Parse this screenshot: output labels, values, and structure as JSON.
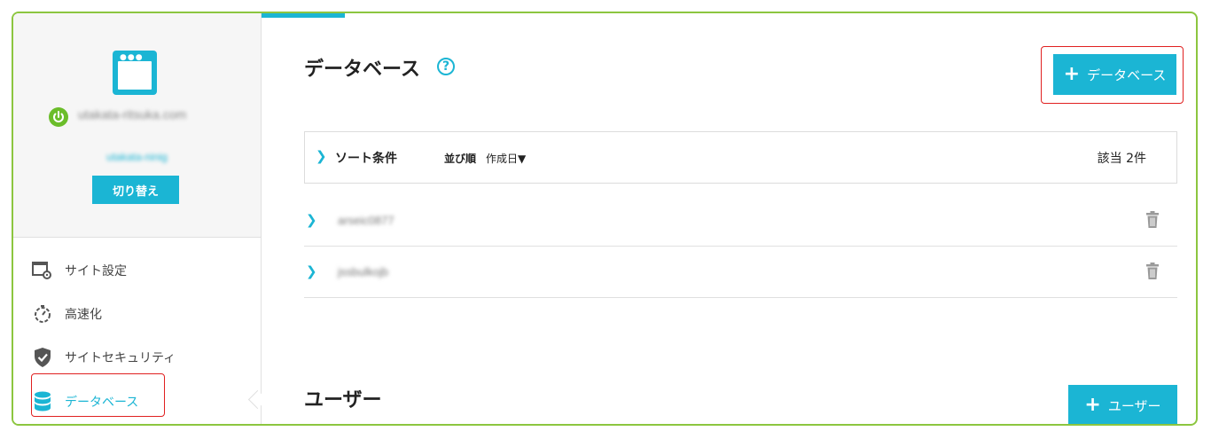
{
  "sidebar": {
    "domain": "utakata-ritsuka.com",
    "account": "utakata-ninig",
    "switch_label": "切り替え",
    "nav": [
      {
        "label": "サイト設定",
        "icon": "site-settings-icon"
      },
      {
        "label": "高速化",
        "icon": "stopwatch-icon"
      },
      {
        "label": "サイトセキュリティ",
        "icon": "shield-check-icon"
      },
      {
        "label": "データベース",
        "icon": "database-icon",
        "active": true
      }
    ]
  },
  "main": {
    "title": "データベース",
    "help": "?",
    "add_database_label": "データベース",
    "sort": {
      "title": "ソート条件",
      "key_label": "並び順",
      "key_value": "作成日▼",
      "count": "該当 2件"
    },
    "databases": [
      {
        "name": "arseic0877"
      },
      {
        "name": "jssbulkojb"
      }
    ],
    "users_title": "ユーザー",
    "add_user_label": "ユーザー"
  },
  "colors": {
    "accent": "#1bb5d4",
    "frame_border": "#8cc63f",
    "highlight": "#e02020",
    "power": "#6bbd2a"
  }
}
